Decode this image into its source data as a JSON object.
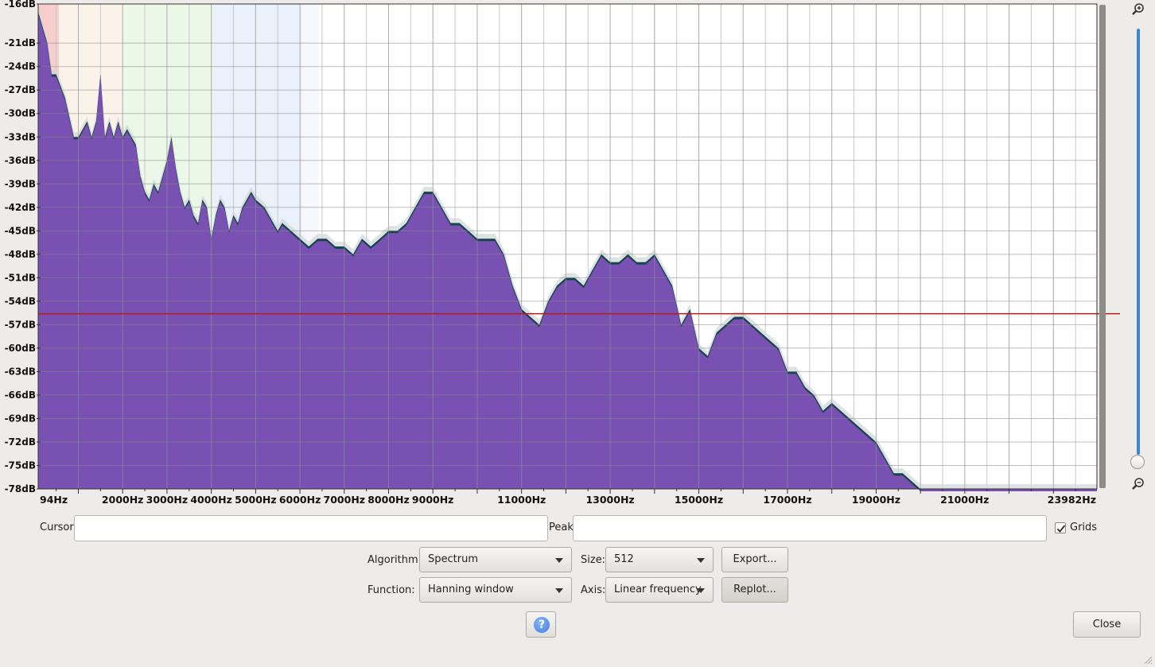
{
  "colors": {
    "accent": "#3b86df",
    "spectrum_fill": "#7851b2",
    "spectrum_edge": "#17444b",
    "peak_line": "#b51d1d"
  },
  "chart_data": {
    "type": "area",
    "xlabel": "",
    "ylabel": "",
    "xlim": [
      94,
      23982
    ],
    "ylim": [
      -78,
      -16
    ],
    "grid": true,
    "yticks": [
      "-16dB",
      "-21dB",
      "-24dB",
      "-27dB",
      "-30dB",
      "-33dB",
      "-36dB",
      "-39dB",
      "-42dB",
      "-45dB",
      "-48dB",
      "-51dB",
      "-54dB",
      "-57dB",
      "-60dB",
      "-63dB",
      "-66dB",
      "-69dB",
      "-72dB",
      "-75dB",
      "-78dB"
    ],
    "xticks": [
      "94Hz",
      "2000Hz",
      "3000Hz",
      "4000Hz",
      "5000Hz",
      "6000Hz",
      "7000Hz",
      "8000Hz",
      "9000Hz",
      "11000Hz",
      "13000Hz",
      "15000Hz",
      "17000Hz",
      "19000Hz",
      "21000Hz",
      "23982Hz"
    ],
    "peak_line_db": -55.6,
    "series": [
      {
        "x": [
          94,
          300,
          400,
          500,
          700,
          900,
          1000,
          1200,
          1300,
          1400,
          1500,
          1600,
          1700,
          1800,
          1900,
          2000,
          2100,
          2200,
          2300,
          2400,
          2500,
          2600,
          2700,
          2800,
          2900,
          3000,
          3100,
          3200,
          3300,
          3400,
          3500,
          3600,
          3700,
          3800,
          3900,
          4000,
          4100,
          4200,
          4300,
          4400,
          4500,
          4600,
          4700,
          4800,
          4900,
          5000,
          5200,
          5400,
          5500,
          5600,
          5800,
          6000,
          6200,
          6400,
          6600,
          6800,
          7000,
          7200,
          7400,
          7600,
          7800,
          8000,
          8200,
          8400,
          8600,
          8800,
          9000,
          9200,
          9400,
          9600,
          9800,
          10000,
          10200,
          10400,
          10600,
          10800,
          11000,
          11200,
          11400,
          11600,
          11800,
          12000,
          12200,
          12400,
          12600,
          12800,
          13000,
          13200,
          13400,
          13600,
          13800,
          14000,
          14200,
          14400,
          14600,
          14800,
          15000,
          15200,
          15400,
          15600,
          15800,
          16000,
          16200,
          16400,
          16600,
          16800,
          17000,
          17200,
          17400,
          17600,
          17800,
          18000,
          18200,
          18400,
          18600,
          18800,
          19000,
          19200,
          19400,
          19600,
          19800,
          20000,
          20200,
          20500,
          21000,
          21500,
          22000,
          22500,
          23000,
          23500,
          23982
        ],
        "values": [
          -17,
          -21,
          -25,
          -25,
          -28,
          -33,
          -33,
          -31,
          -33,
          -31,
          -25,
          -33,
          -31,
          -33,
          -31,
          -33,
          -32,
          -33,
          -34,
          -38,
          -40,
          -41,
          -39,
          -40,
          -38,
          -36,
          -33,
          -37,
          -40,
          -42,
          -41,
          -43,
          -44,
          -41,
          -42,
          -46,
          -43,
          -41,
          -42,
          -45,
          -43,
          -44,
          -42,
          -41,
          -40,
          -41,
          -42,
          -44,
          -45,
          -44,
          -45,
          -46,
          -47,
          -46,
          -46,
          -47,
          -47,
          -48,
          -46,
          -47,
          -46,
          -45,
          -45,
          -44,
          -42,
          -40,
          -40,
          -42,
          -44,
          -44,
          -45,
          -46,
          -46,
          -46,
          -48,
          -52,
          -55,
          -56,
          -57,
          -54,
          -52,
          -51,
          -51,
          -52,
          -50,
          -48,
          -49,
          -49,
          -48,
          -49,
          -49,
          -48,
          -50,
          -52,
          -57,
          -55,
          -60,
          -61,
          -58,
          -57,
          -56,
          -56,
          -57,
          -58,
          -59,
          -60,
          -63,
          -63,
          -65,
          -66,
          -68,
          -67,
          -68,
          -69,
          -70,
          -71,
          -72,
          -74,
          -76,
          -76,
          -77,
          -78,
          -78,
          -78,
          -78,
          -78,
          -78,
          -78,
          -78,
          -78,
          -78
        ]
      }
    ]
  },
  "controls": {
    "cursor_label": "Cursor:",
    "cursor_value": "",
    "peak_label": "Peak:",
    "peak_value": "",
    "grids_label": "Grids",
    "grids_checked": true,
    "algorithm_label": "Algorithm:",
    "algorithm_value": "Spectrum",
    "size_label": "Size:",
    "size_value": "512",
    "function_label": "Function:",
    "function_value": "Hanning window",
    "axis_label": "Axis:",
    "axis_value": "Linear frequency",
    "export_label": "Export...",
    "replot_label": "Replot...",
    "close_label": "Close",
    "help_label": "?"
  },
  "icons": {
    "zoom_in": "zoom-in-icon",
    "zoom_out": "zoom-out-icon"
  }
}
